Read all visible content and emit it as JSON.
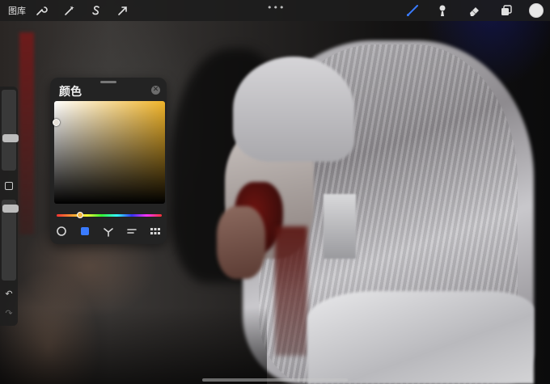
{
  "toolbar": {
    "gallery_label": "图库",
    "tools_left": [
      {
        "name": "actions",
        "icon": "wrench-icon"
      },
      {
        "name": "adjustments",
        "icon": "magic-wand-icon"
      },
      {
        "name": "selection",
        "icon": "selection-s-icon"
      },
      {
        "name": "transform",
        "icon": "arrow-cursor-icon"
      }
    ],
    "more_label": "•••",
    "tools_right": [
      {
        "name": "brush",
        "icon": "brush-icon",
        "active": true,
        "color": "#3a7bff"
      },
      {
        "name": "smudge",
        "icon": "smudge-icon"
      },
      {
        "name": "eraser",
        "icon": "eraser-icon"
      },
      {
        "name": "layers",
        "icon": "layers-icon"
      }
    ],
    "active_color": "#e8e8e8"
  },
  "sidebar": {
    "brush_size_level": 0.55,
    "opacity_level": 0.9,
    "undo_icon": "undo-icon",
    "redo_icon": "redo-icon"
  },
  "color_panel": {
    "title": "颜色",
    "close_icon": "close-icon",
    "hue_color": "#f0b42a",
    "selected_color": "#e6e0d8",
    "modes": [
      {
        "name": "disc",
        "icon": "disc-icon"
      },
      {
        "name": "classic",
        "icon": "square-icon",
        "active": true
      },
      {
        "name": "harmony",
        "icon": "harmony-icon"
      },
      {
        "name": "value",
        "icon": "value-icon"
      },
      {
        "name": "palettes",
        "icon": "grid-icon"
      }
    ]
  }
}
